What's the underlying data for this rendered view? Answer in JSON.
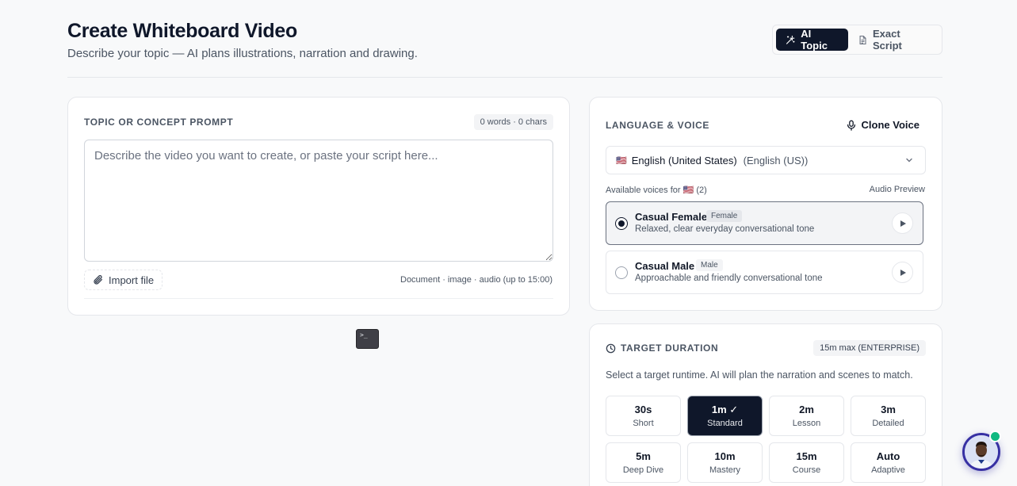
{
  "header": {
    "title": "Create Whiteboard Video",
    "subtitle": "Describe your topic — AI plans illustrations, narration and drawing.",
    "modes": [
      {
        "label": "AI Topic",
        "icon": "magic-wand-icon",
        "active": true
      },
      {
        "label": "Exact Script",
        "icon": "document-icon",
        "active": false
      }
    ]
  },
  "prompt": {
    "label": "TOPIC OR CONCEPT PROMPT",
    "count": "0 words · 0 chars",
    "value": "",
    "placeholder": "Describe the video you want to create, or paste your script here...",
    "import_label": "Import file",
    "file_hint": "Document · image · audio (up to 15:00)"
  },
  "voice": {
    "label": "LANGUAGE & VOICE",
    "clone_label": "Clone Voice",
    "language": {
      "flag": "🇺🇸",
      "name": "English (United States)",
      "native": "(English (US))"
    },
    "available_label": "Available voices for 🇺🇸 (2)",
    "audio_preview_label": "Audio Preview",
    "voices": [
      {
        "name": "Casual Female",
        "gender": "Female",
        "desc": "Relaxed, clear everyday conversational tone",
        "selected": true
      },
      {
        "name": "Casual Male",
        "gender": "Male",
        "desc": "Approachable and friendly conversational tone",
        "selected": false
      }
    ]
  },
  "duration": {
    "label": "TARGET DURATION",
    "max_badge": "15m max (ENTERPRISE)",
    "description": "Select a target runtime. AI will plan the narration and scenes to match.",
    "options": [
      {
        "value": "30s",
        "sub": "Short",
        "selected": false
      },
      {
        "value": "1m ✓",
        "sub": "Standard",
        "selected": true
      },
      {
        "value": "2m",
        "sub": "Lesson",
        "selected": false
      },
      {
        "value": "3m",
        "sub": "Detailed",
        "selected": false
      },
      {
        "value": "5m",
        "sub": "Deep Dive",
        "selected": false
      },
      {
        "value": "10m",
        "sub": "Mastery",
        "selected": false
      },
      {
        "value": "15m",
        "sub": "Course",
        "selected": false
      },
      {
        "value": "Auto",
        "sub": "Adaptive",
        "selected": false
      }
    ]
  },
  "terminal": {
    "glyph": ">_"
  },
  "colors": {
    "primary": "#0f172a",
    "online": "#10b981",
    "avatar_ring": "#3730a3"
  }
}
